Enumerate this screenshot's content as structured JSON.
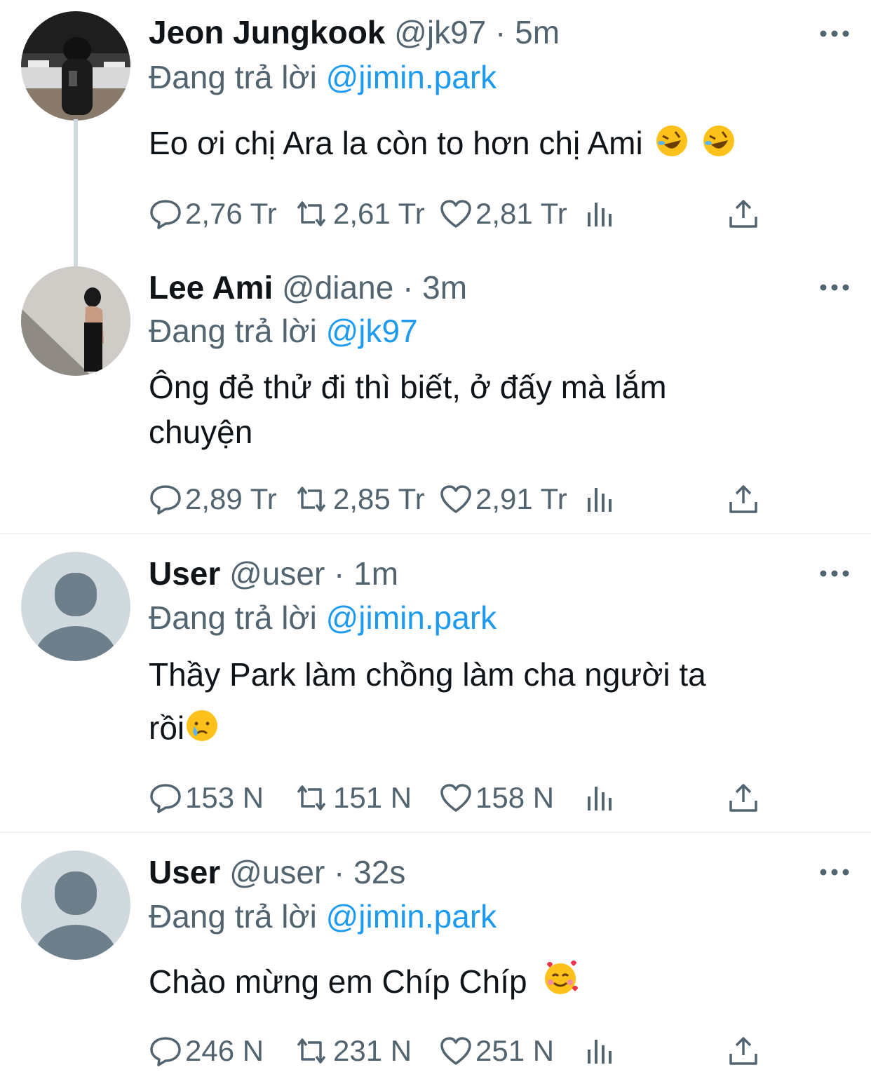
{
  "replying_label": "Đang trả lời",
  "tweets": [
    {
      "name": "Jeon Jungkook",
      "handle": "@jk97",
      "sep": "·",
      "time": "5m",
      "reply_to": "@jimin.park",
      "text": "Eo ơi chị Ara la còn to hơn chị Ami",
      "emoji": [
        "rolling-on-floor-laughing-emoji",
        "rolling-on-floor-laughing-emoji"
      ],
      "replies": "2,76 Tr",
      "retweets": "2,61 Tr",
      "likes": "2,81 Tr"
    },
    {
      "name": "Lee Ami",
      "handle": "@diane",
      "sep": "·",
      "time": "3m",
      "reply_to": "@jk97",
      "text_line1": "Ông đẻ thử đi thì biết, ở đấy mà lắm",
      "text_line2": "chuyện",
      "replies": "2,89 Tr",
      "retweets": "2,85 Tr",
      "likes": "2,91 Tr"
    },
    {
      "name": "User",
      "handle": "@user",
      "sep": "·",
      "time": "1m",
      "reply_to": "@jimin.park",
      "text_line1": "Thầy Park làm chồng làm cha người ta",
      "text_line2": "rồi",
      "emoji": [
        "crying-face-emoji"
      ],
      "replies": "153 N",
      "retweets": "151 N",
      "likes": "158 N"
    },
    {
      "name": "User",
      "handle": "@user",
      "sep": "·",
      "time": "32s",
      "reply_to": "@jimin.park",
      "text": "Chào mừng em Chíp Chíp",
      "emoji": [
        "smiling-face-with-hearts-emoji"
      ],
      "replies": "246 N",
      "retweets": "231 N",
      "likes": "251 N"
    }
  ],
  "colors": {
    "accent": "#1d9bf0",
    "muted": "#536471",
    "text": "#0f1419",
    "divider": "#eff3f4",
    "thread": "#cfd9de"
  }
}
